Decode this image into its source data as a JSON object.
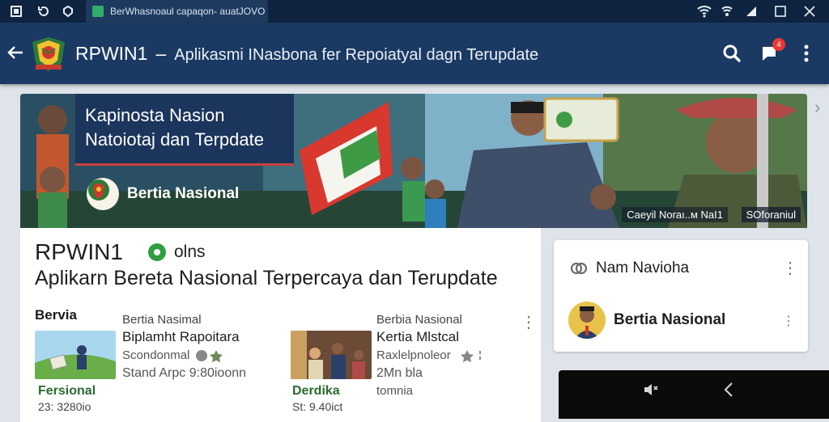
{
  "window": {
    "tab_title": "BerWhasnoaul capaqon- auatJOVO"
  },
  "appbar": {
    "title": "RPWIN1",
    "dash": "–",
    "subtitle": "Aplikasmi INasbona fer Repoiatyal dagn Terupdate",
    "notification_count": "4"
  },
  "banner": {
    "headline_line1": "Kapinosta Nasion",
    "headline_line2": "Natoiotaj dan Terpdate",
    "brand": "Bertia Nasional",
    "credit_left": "Caeyil Noraı..ᴍ NaI1",
    "credit_right": "SOforaniul"
  },
  "main_card": {
    "title": "RPWIN1",
    "status": "olns",
    "subtitle": "Aplikarn Bereta Nasional Terpercaya dan Terupdate",
    "section_label": "Bervia",
    "news": [
      {
        "category": "Bertia Nasimal",
        "headline": "Biplamht Rapoitara",
        "meta": "Scondonmal",
        "meta2": "Stand Arpc 9:80ioonn",
        "tag": "Fersional",
        "stat": "23: 3280io"
      },
      {
        "category": "Berbia Nasional",
        "headline": "Kertia Mlstcal",
        "meta": "Raxlelpnoleor",
        "meta2": "2Mn bla",
        "tag": "Derdika",
        "stat": "St: 9.40ict",
        "stat2": "tomnia"
      }
    ]
  },
  "side_card": {
    "row1": "Nam Navioha",
    "row2": "Bertia Nasional"
  },
  "colors": {
    "appbar": "#1b3a63",
    "statusbar": "#0f2440",
    "accent_green": "#2e9e3f",
    "badge_red": "#e53935"
  }
}
